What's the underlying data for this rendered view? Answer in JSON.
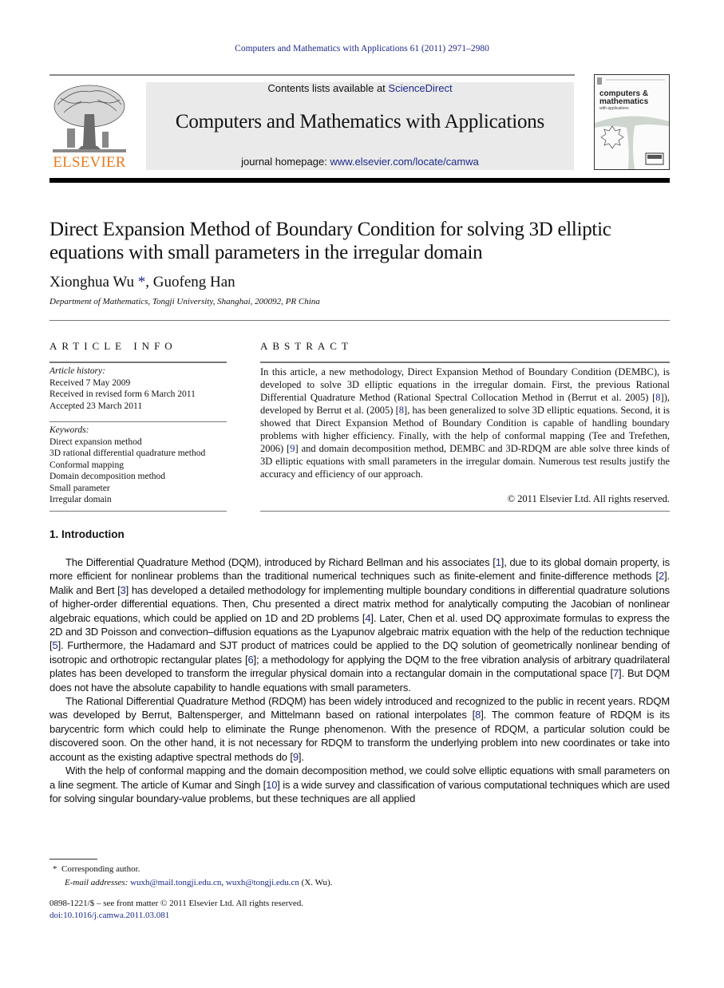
{
  "running_head": "Computers and Mathematics with Applications 61 (2011) 2971–2980",
  "masthead": {
    "publisher_logo_text": "ELSEVIER",
    "contents_prefix": "Contents lists available at ",
    "contents_link": "ScienceDirect",
    "journal_title": "Computers and Mathematics with Applications",
    "homepage_prefix": "journal homepage: ",
    "homepage_link": "www.elsevier.com/locate/camwa",
    "cover": {
      "line1": "computers &",
      "line2": "mathematics",
      "line3": "with applications"
    }
  },
  "article": {
    "title": "Direct Expansion Method of Boundary Condition for solving 3D elliptic equations with small parameters in the irregular domain",
    "authors": [
      {
        "name": "Xionghua Wu",
        "mark": "*"
      },
      {
        "name": "Guofeng Han",
        "mark": ""
      }
    ],
    "author_separator": ", ",
    "affiliation": "Department of Mathematics, Tongji University, Shanghai, 200092, PR China"
  },
  "article_info": {
    "heading": "ARTICLE INFO",
    "history_label": "Article history:",
    "history": [
      "Received 7 May 2009",
      "Received in revised form 6 March 2011",
      "Accepted 23 March 2011"
    ],
    "keywords_label": "Keywords:",
    "keywords": [
      "Direct expansion method",
      "3D rational differential quadrature method",
      "Conformal mapping",
      "Domain decomposition method",
      "Small parameter",
      "Irregular domain"
    ]
  },
  "abstract": {
    "heading": "ABSTRACT",
    "parts": [
      "In this article, a new methodology, Direct Expansion Method of Boundary Condition (DEMBC), is developed to solve 3D elliptic equations in the irregular domain. First, the previous Rational Differential Quadrature Method (Rational Spectral Collocation Method in (Berrut et al. 2005) [",
      "8",
      "]), developed by Berrut et al. (2005) [",
      "8",
      "], has been generalized to solve 3D elliptic equations. Second, it is showed that Direct Expansion Method of Boundary Condition is capable of handling boundary problems with higher efficiency. Finally, with the help of conformal mapping (Tee and Trefethen, 2006) [",
      "9",
      "] and domain decomposition method, DEMBC and 3D-RDQM are able solve three kinds of 3D elliptic equations with small parameters in the irregular domain. Numerous test results justify the accuracy and efficiency of our approach."
    ],
    "copyright": "© 2011 Elsevier Ltd. All rights reserved."
  },
  "introduction": {
    "heading": "1. Introduction",
    "paragraphs": [
      [
        "The Differential Quadrature Method (DQM), introduced by Richard Bellman and his associates [",
        "1",
        "], due to its global domain property, is more efficient for nonlinear problems than the traditional numerical techniques such as finite-element and finite-difference methods [",
        "2",
        "]. Malik and Bert [",
        "3",
        "] has developed a detailed methodology for implementing multiple boundary conditions in differential quadrature solutions of higher-order differential equations. Then, Chu presented a direct matrix method for analytically computing the Jacobian of nonlinear algebraic equations, which could be applied on 1D and 2D problems [",
        "4",
        "]. Later, Chen et al. used DQ approximate formulas to express the 2D and 3D Poisson and convection–diffusion equations as the Lyapunov algebraic matrix equation with the help of the reduction technique [",
        "5",
        "]. Furthermore, the Hadamard and SJT product of matrices could be applied to the DQ solution of geometrically nonlinear bending of isotropic and orthotropic rectangular plates [",
        "6",
        "]; a methodology for applying the DQM to the free vibration analysis of arbitrary quadrilateral plates has been developed to transform the irregular physical domain into a rectangular domain in the computational space [",
        "7",
        "]. But DQM does not have the absolute capability to handle equations with small parameters."
      ],
      [
        "The Rational Differential Quadrature Method (RDQM) has been widely introduced and recognized to the public in recent years. RDQM was developed by Berrut, Baltensperger, and Mittelmann based on rational interpolates [",
        "8",
        "]. The common feature of RDQM is its barycentric form which could help to eliminate the Runge phenomenon. With the presence of RDQM, a particular solution could be discovered soon. On the other hand, it is not necessary for RDQM to transform the underlying problem into new coordinates or take into account as the existing adaptive spectral methods do [",
        "9",
        "]."
      ],
      [
        "With the help of conformal mapping and the domain decomposition method, we could solve elliptic equations with small parameters on a line segment. The article of Kumar and Singh [",
        "10",
        "] is a wide survey and classification of various computational techniques which are used for solving singular boundary-value problems, but these techniques are all applied"
      ]
    ]
  },
  "footnotes": {
    "mark": "*",
    "corresponding": "Corresponding author.",
    "email_label": "E-mail addresses: ",
    "emails": [
      "wuxh@mail.tongji.edu.cn",
      "wuxh@tongji.edu.cn"
    ],
    "email_separator": ", ",
    "email_owner": " (X. Wu)."
  },
  "issn_line": "0898-1221/$ – see front matter © 2011 Elsevier Ltd. All rights reserved.",
  "doi": "doi:10.1016/j.camwa.2011.03.081",
  "colors": {
    "link": "#1c2a8a",
    "elsevier_orange": "#e97a1d",
    "banner_gray": "#eaeaea"
  }
}
